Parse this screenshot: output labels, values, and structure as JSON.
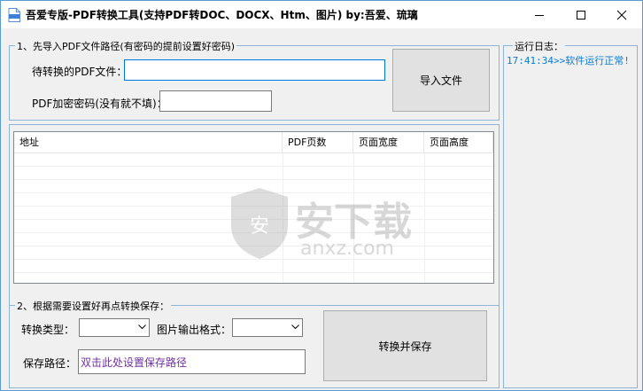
{
  "window": {
    "title": "吾爱专版-PDF转换工具(支持PDF转DOC、DOCX、Htm、图片)  by:吾爱、琉璃",
    "minimize_icon": "minimize-icon",
    "maximize_icon": "maximize-icon",
    "close_icon": "close-icon"
  },
  "import_group": {
    "legend": "1、先导入PDF文件路径(有密码的提前设置好密码)",
    "file_label": "待转换的PDF文件：",
    "file_value": "",
    "password_label": "PDF加密密码(没有就不填)：",
    "password_value": "",
    "import_button": "导入文件"
  },
  "table": {
    "columns": [
      "地址",
      "PDF页数",
      "页面宽度",
      "页面高度"
    ],
    "rows": []
  },
  "convert_group": {
    "legend": "2、根据需要设置好再点转换保存：",
    "type_label": "转换类型：",
    "type_value": "",
    "image_format_label": "图片输出格式：",
    "image_format_value": "",
    "save_path_label": "保存路径：",
    "save_path_value": "双击此处设置保存路径",
    "convert_button": "转换并保存"
  },
  "log": {
    "legend": "运行日志：",
    "lines": [
      "17:41:34>>软件运行正常!"
    ]
  },
  "watermark": {
    "text": "安下载",
    "subtext": "anxz.com"
  },
  "colors": {
    "accent": "#0078d7",
    "log_text": "#0a7bd1",
    "path_text": "#7030a0",
    "group_border": "#8fb4d9"
  }
}
